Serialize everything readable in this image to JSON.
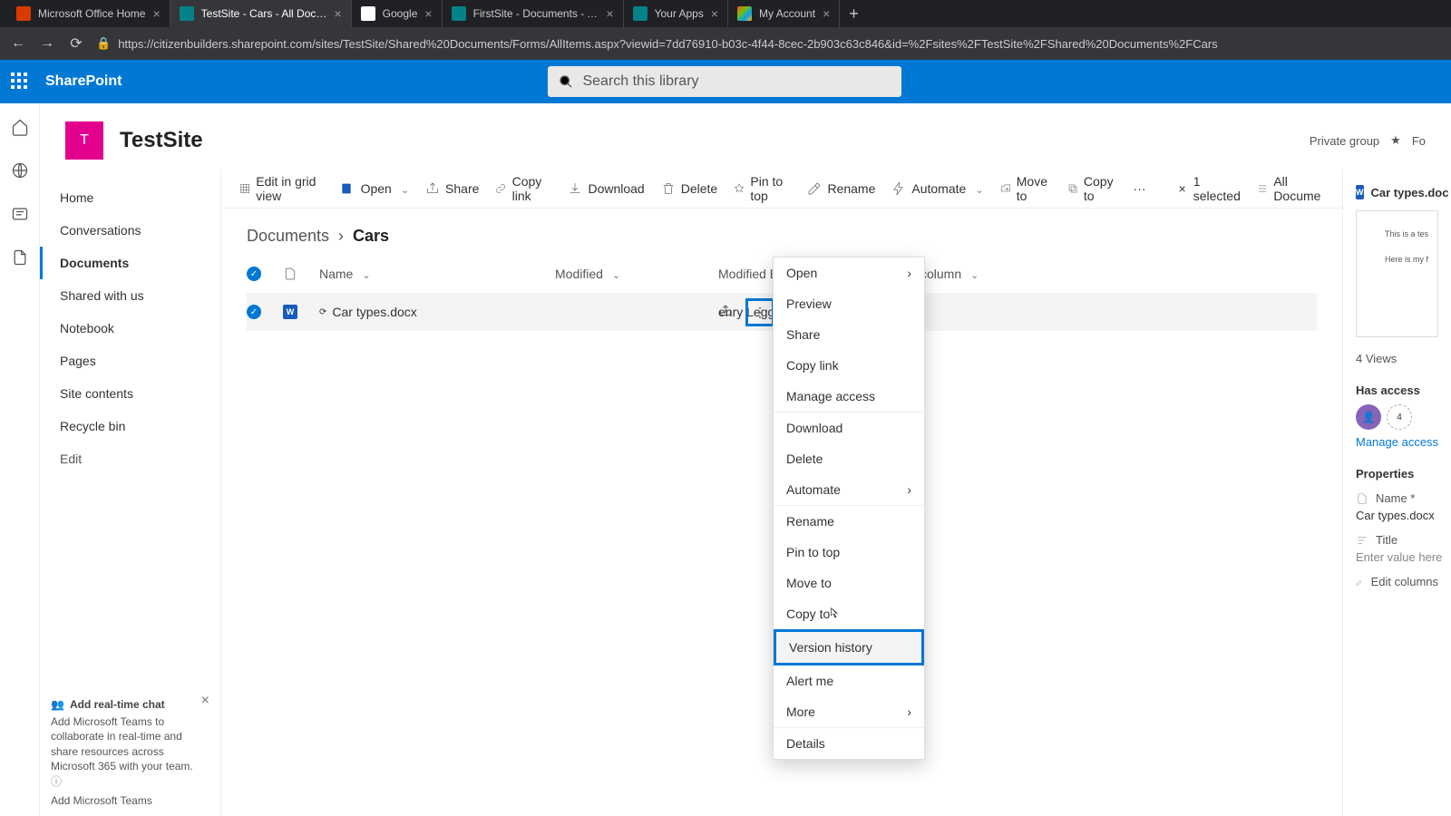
{
  "browser": {
    "tabs": [
      {
        "title": "Microsoft Office Home",
        "fav": "#d83b01"
      },
      {
        "title": "TestSite - Cars - All Documents",
        "fav": "#038387",
        "active": true
      },
      {
        "title": "Google",
        "fav": "#4285f4"
      },
      {
        "title": "FirstSite - Documents - All Docu",
        "fav": "#038387"
      },
      {
        "title": "Your Apps",
        "fav": "#038387"
      },
      {
        "title": "My Account",
        "fav": "#00a4ef"
      }
    ],
    "url": "https://citizenbuilders.sharepoint.com/sites/TestSite/Shared%20Documents/Forms/AllItems.aspx?viewid=7dd76910-b03c-4f44-8cec-2b903c63c846&id=%2Fsites%2FTestSite%2FShared%20Documents%2FCars"
  },
  "suite": {
    "brand": "SharePoint",
    "search_placeholder": "Search this library"
  },
  "site": {
    "initial": "T",
    "name": "TestSite",
    "group": "Private group",
    "follow": "Fo"
  },
  "leftnav": {
    "items": [
      "Home",
      "Conversations",
      "Documents",
      "Shared with us",
      "Notebook",
      "Pages",
      "Site contents",
      "Recycle bin"
    ],
    "selected": "Documents",
    "edit": "Edit"
  },
  "cmdbar": {
    "edit_grid": "Edit in grid view",
    "open": "Open",
    "share": "Share",
    "copy_link": "Copy link",
    "download": "Download",
    "delete": "Delete",
    "pin": "Pin to top",
    "rename": "Rename",
    "automate": "Automate",
    "move": "Move to",
    "copy": "Copy to",
    "selected": "1 selected",
    "view": "All Docume"
  },
  "breadcrumb": {
    "root": "Documents",
    "current": "Cars"
  },
  "columns": {
    "name": "Name",
    "modified": "Modified",
    "modified_by": "Modified By",
    "add": "Add column"
  },
  "row": {
    "filename": "Car types.docx",
    "modified_by": "enry Legge"
  },
  "context_menu": {
    "open": "Open",
    "preview": "Preview",
    "share": "Share",
    "copy_link": "Copy link",
    "manage_access": "Manage access",
    "download": "Download",
    "delete": "Delete",
    "automate": "Automate",
    "rename": "Rename",
    "pin": "Pin to top",
    "move": "Move to",
    "copy": "Copy to",
    "version": "Version history",
    "alert": "Alert me",
    "more": "More",
    "details": "Details"
  },
  "details": {
    "filename": "Car types.doc",
    "preview_l1": "This is a tes",
    "preview_l2": "Here is my f",
    "views": "4 Views",
    "has_access": "Has access",
    "access_count": "4",
    "manage": "Manage access",
    "properties": "Properties",
    "name_lbl": "Name *",
    "name_val": "Car types.docx",
    "title_lbl": "Title",
    "title_ph": "Enter value here",
    "edit_cols": "Edit columns"
  },
  "teams": {
    "title": "Add real-time chat",
    "body": "Add Microsoft Teams to collaborate in real-time and share resources across Microsoft 365 with your team.",
    "link": "Add Microsoft Teams"
  }
}
